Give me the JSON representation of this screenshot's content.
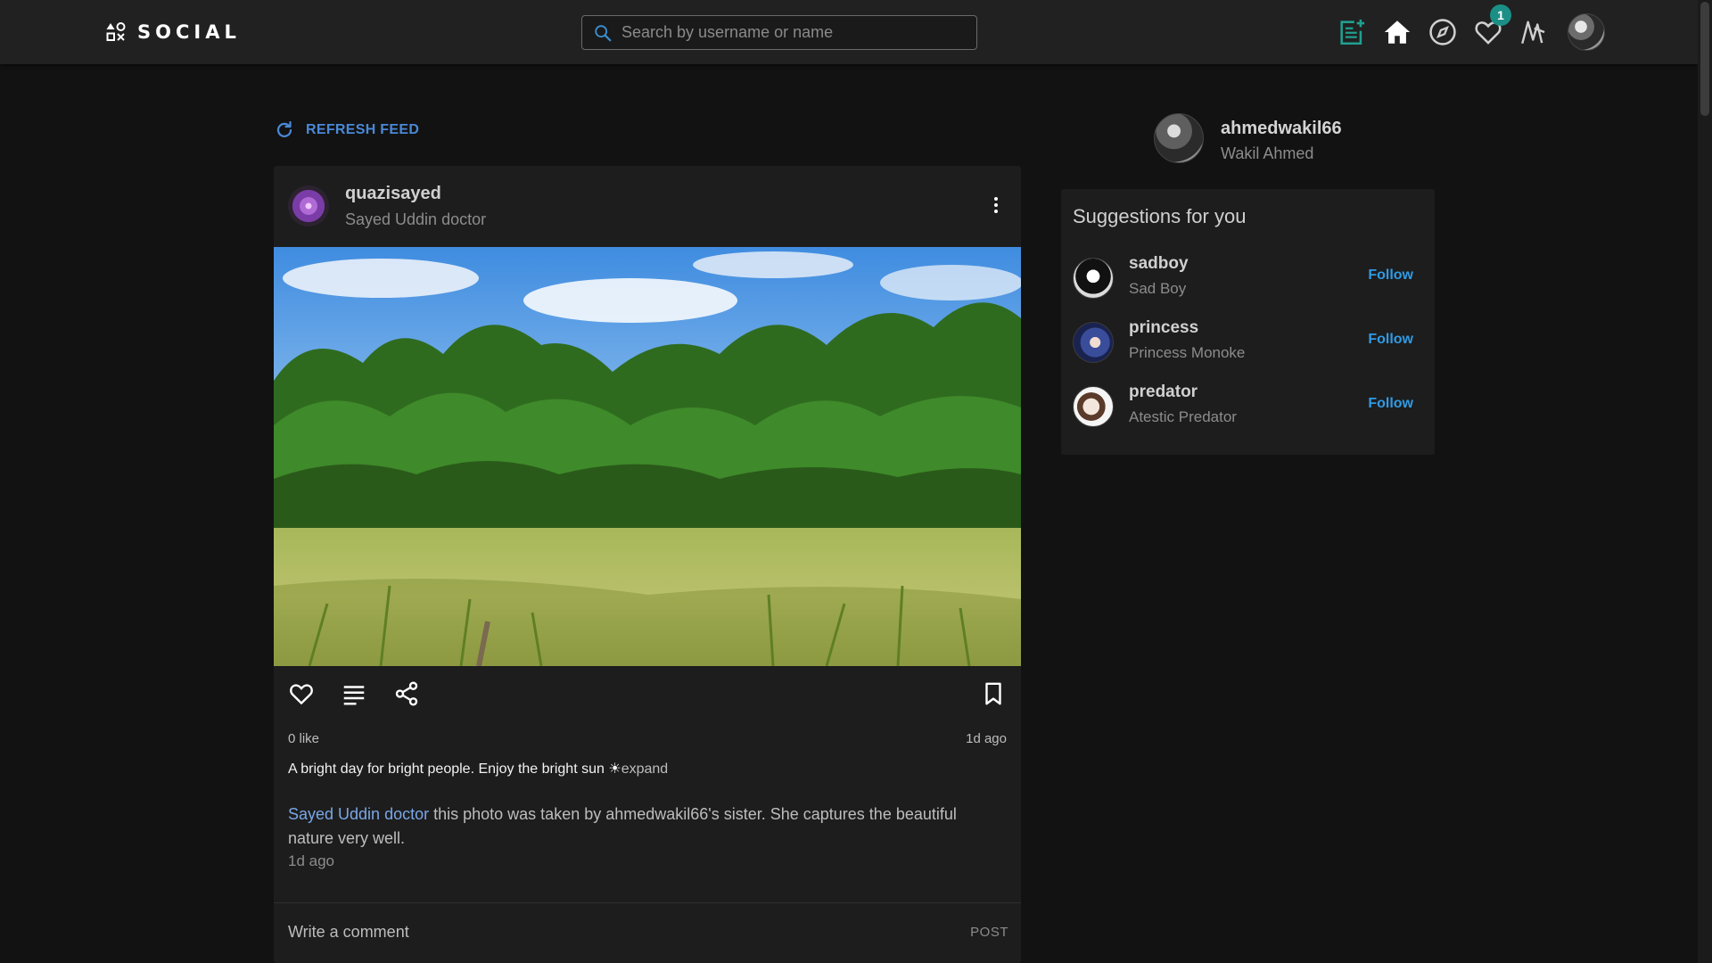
{
  "header": {
    "logo_text": "SOCIAL",
    "search_placeholder": "Search by username or name",
    "notification_count": "1",
    "icons": [
      "new-post-icon",
      "home-icon",
      "explore-icon",
      "heart-icon",
      "activity-icon"
    ]
  },
  "feed": {
    "refresh_label": "REFRESH FEED",
    "post": {
      "username": "quazisayed",
      "full_name": "Sayed Uddin doctor",
      "image_alt": "Green trees and grass field under a blue sky",
      "likes": "0 like",
      "time": "1d ago",
      "caption": "A bright day for bright people. Enjoy the bright sun ☀",
      "expand_label": "expand",
      "comment": {
        "author": "Sayed Uddin doctor",
        "text": " this photo was taken by ahmedwakil66's sister. She captures the beautiful nature very well.",
        "time": "1d ago"
      },
      "comment_placeholder": "Write a comment",
      "post_label": "POST"
    }
  },
  "sidebar": {
    "me": {
      "username": "ahmedwakil66",
      "full_name": "Wakil Ahmed"
    },
    "suggestions_title": "Suggestions for you",
    "suggestions": [
      {
        "username": "sadboy",
        "full_name": "Sad Boy",
        "follow_label": "Follow"
      },
      {
        "username": "princess",
        "full_name": "Princess Monoke",
        "follow_label": "Follow"
      },
      {
        "username": "predator",
        "full_name": "Atestic Predator",
        "follow_label": "Follow"
      }
    ]
  },
  "colors": {
    "background": "#121212",
    "card": "#1d1d1d",
    "accent_teal": "#1b8f86",
    "link_blue": "#4a88d8",
    "follow_blue": "#2f9be6"
  }
}
